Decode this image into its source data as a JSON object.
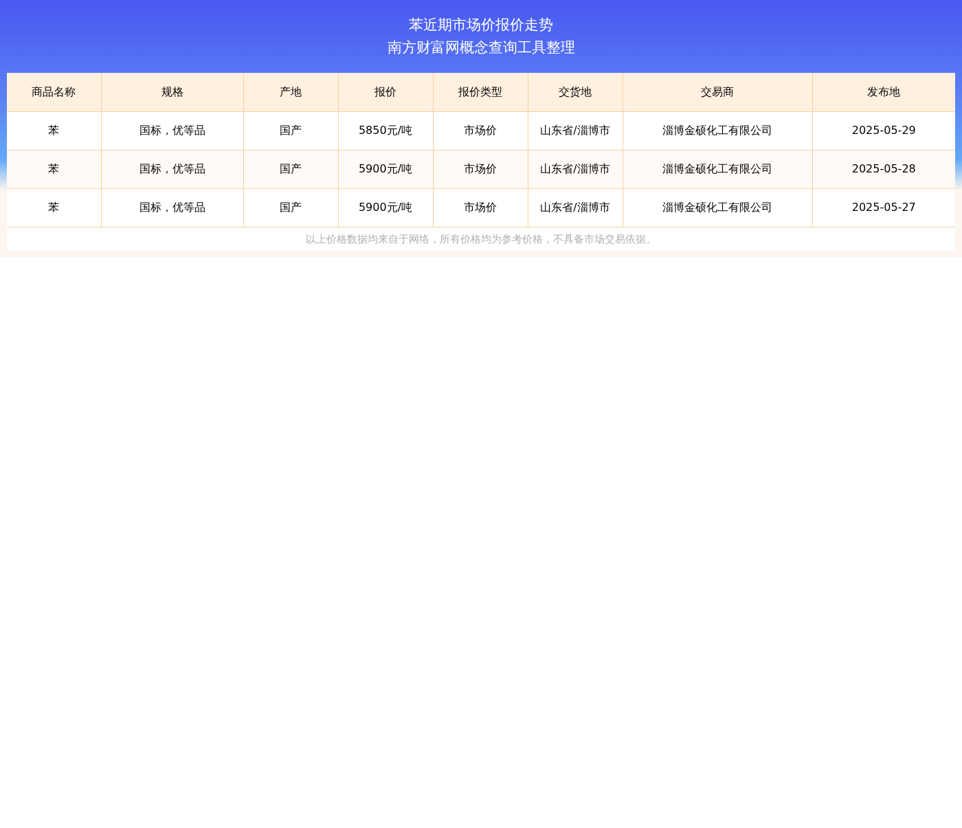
{
  "header": {
    "title": "苯近期市场价报价走势",
    "subtitle": "南方财富网概念查询工具整理"
  },
  "table": {
    "columns": [
      "商品名称",
      "规格",
      "产地",
      "报价",
      "报价类型",
      "交货地",
      "交易商",
      "发布地"
    ],
    "rows": [
      [
        "苯",
        "国标，优等品",
        "国产",
        "5850元/吨",
        "市场价",
        "山东省/淄博市",
        "淄博金硕化工有限公司",
        "2025-05-29"
      ],
      [
        "苯",
        "国标，优等品",
        "国产",
        "5900元/吨",
        "市场价",
        "山东省/淄博市",
        "淄博金硕化工有限公司",
        "2025-05-28"
      ],
      [
        "苯",
        "国标，优等品",
        "国产",
        "5900元/吨",
        "市场价",
        "山东省/淄博市",
        "淄博金硕化工有限公司",
        "2025-05-27"
      ]
    ]
  },
  "note": "以上价格数据均来自于网络，所有价格均为参考价格，不具备市场交易依据。"
}
